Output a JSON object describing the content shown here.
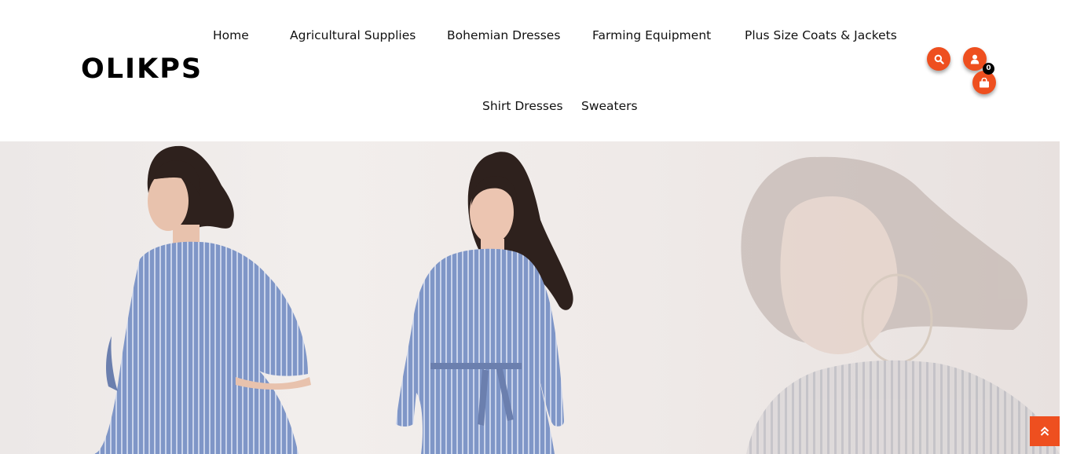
{
  "brand": {
    "logo_text": "OLIKPS"
  },
  "nav": {
    "items": [
      {
        "label": "Home"
      },
      {
        "label": "Agricultural Supplies"
      },
      {
        "label": "Bohemian Dresses"
      },
      {
        "label": "Farming Equipment"
      },
      {
        "label": "Plus Size Coats & Jackets"
      },
      {
        "label": "Shirt Dresses"
      },
      {
        "label": "Sweaters"
      }
    ]
  },
  "header_icons": {
    "search_icon": "search-icon",
    "account_icon": "user-icon",
    "cart_icon": "shopping-bag-icon",
    "cart_count": "0"
  },
  "hero": {
    "image_description_icon": "hero-banner-image",
    "dress_color": "#7f96c7"
  },
  "colors": {
    "accent": "#ee4f1f",
    "background": "#ffffff",
    "text": "#111111"
  },
  "back_to_top_icon": "double-chevron-up-icon"
}
